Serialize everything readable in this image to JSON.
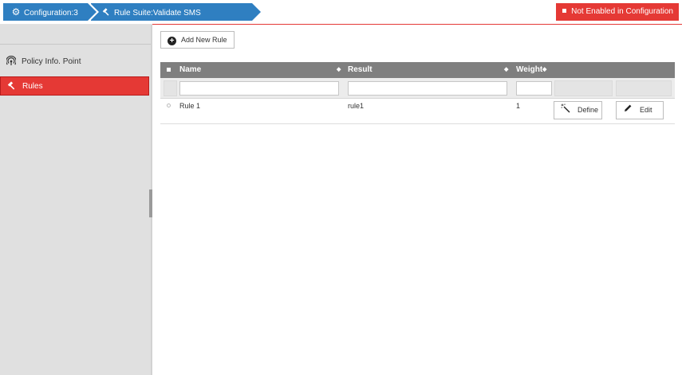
{
  "breadcrumbs": [
    {
      "label": "Configuration:3",
      "icon": "gear-icon"
    },
    {
      "label": "Rule Suite:Validate SMS Authentication",
      "icon": "gavel-icon"
    }
  ],
  "status_badge": {
    "label": "Not Enabled in Configuration",
    "color": "#e53935"
  },
  "sidebar": {
    "items": [
      {
        "label": "Policy Info. Point",
        "icon": "signal-icon",
        "active": false
      },
      {
        "label": "Rules",
        "icon": "gavel-icon",
        "active": true
      }
    ]
  },
  "toolbar": {
    "add_rule_label": "Add New Rule",
    "add_rule_icon": "plus-circle-icon"
  },
  "grid": {
    "columns": [
      "Name",
      "Result",
      "Weight"
    ],
    "filters": {
      "name": "",
      "result": "",
      "weight": ""
    },
    "rows": [
      {
        "name": "Rule 1",
        "result": "rule1",
        "weight": "1",
        "define_label": "Define",
        "edit_label": "Edit"
      }
    ]
  },
  "colors": {
    "accent": "#2f7fc1",
    "danger": "#e53935",
    "header_gray": "#7f7f7f"
  }
}
